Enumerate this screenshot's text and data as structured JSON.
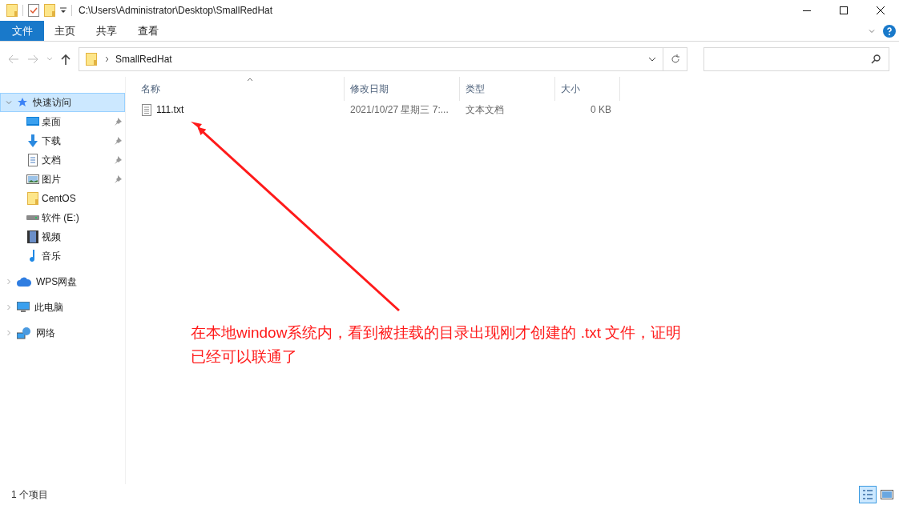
{
  "window": {
    "title": "C:\\Users\\Administrator\\Desktop\\SmallRedHat"
  },
  "ribbon_tabs": [
    {
      "label": "文件",
      "selected": true
    },
    {
      "label": "主页",
      "selected": false
    },
    {
      "label": "共享",
      "selected": false
    },
    {
      "label": "查看",
      "selected": false
    }
  ],
  "address_bar": {
    "crumb": "SmallRedHat"
  },
  "sidebar": {
    "items": [
      {
        "label": "快速访问",
        "kind": "star",
        "selected": true,
        "expanded": true,
        "children": [
          {
            "label": "桌面",
            "kind": "desktop",
            "pinned": true
          },
          {
            "label": "下载",
            "kind": "download",
            "pinned": true
          },
          {
            "label": "文档",
            "kind": "document",
            "pinned": true
          },
          {
            "label": "图片",
            "kind": "picture",
            "pinned": true
          },
          {
            "label": "CentOS",
            "kind": "folder",
            "pinned": false
          },
          {
            "label": "软件 (E:)",
            "kind": "drive",
            "pinned": false
          },
          {
            "label": "视频",
            "kind": "video",
            "pinned": false
          },
          {
            "label": "音乐",
            "kind": "music",
            "pinned": false
          }
        ]
      },
      {
        "label": "WPS网盘",
        "kind": "cloud",
        "selected": false,
        "expanded": false
      },
      {
        "label": "此电脑",
        "kind": "computer",
        "selected": false,
        "expanded": false
      },
      {
        "label": "网络",
        "kind": "network",
        "selected": false,
        "expanded": false
      }
    ]
  },
  "table": {
    "columns": [
      "名称",
      "修改日期",
      "类型",
      "大小"
    ],
    "rows": [
      {
        "name": "111.txt",
        "modified": "2021/10/27 星期三 7:...",
        "type": "文本文档",
        "size": "0 KB"
      }
    ]
  },
  "annotation": {
    "text": "在本地window系统内，看到被挂载的目录出现刚才创建的 .txt 文件，证明已经可以联通了"
  },
  "status_bar": {
    "count": "1 个项目",
    "views": [
      {
        "kind": "details",
        "selected": true
      },
      {
        "kind": "preview",
        "selected": false
      }
    ]
  }
}
